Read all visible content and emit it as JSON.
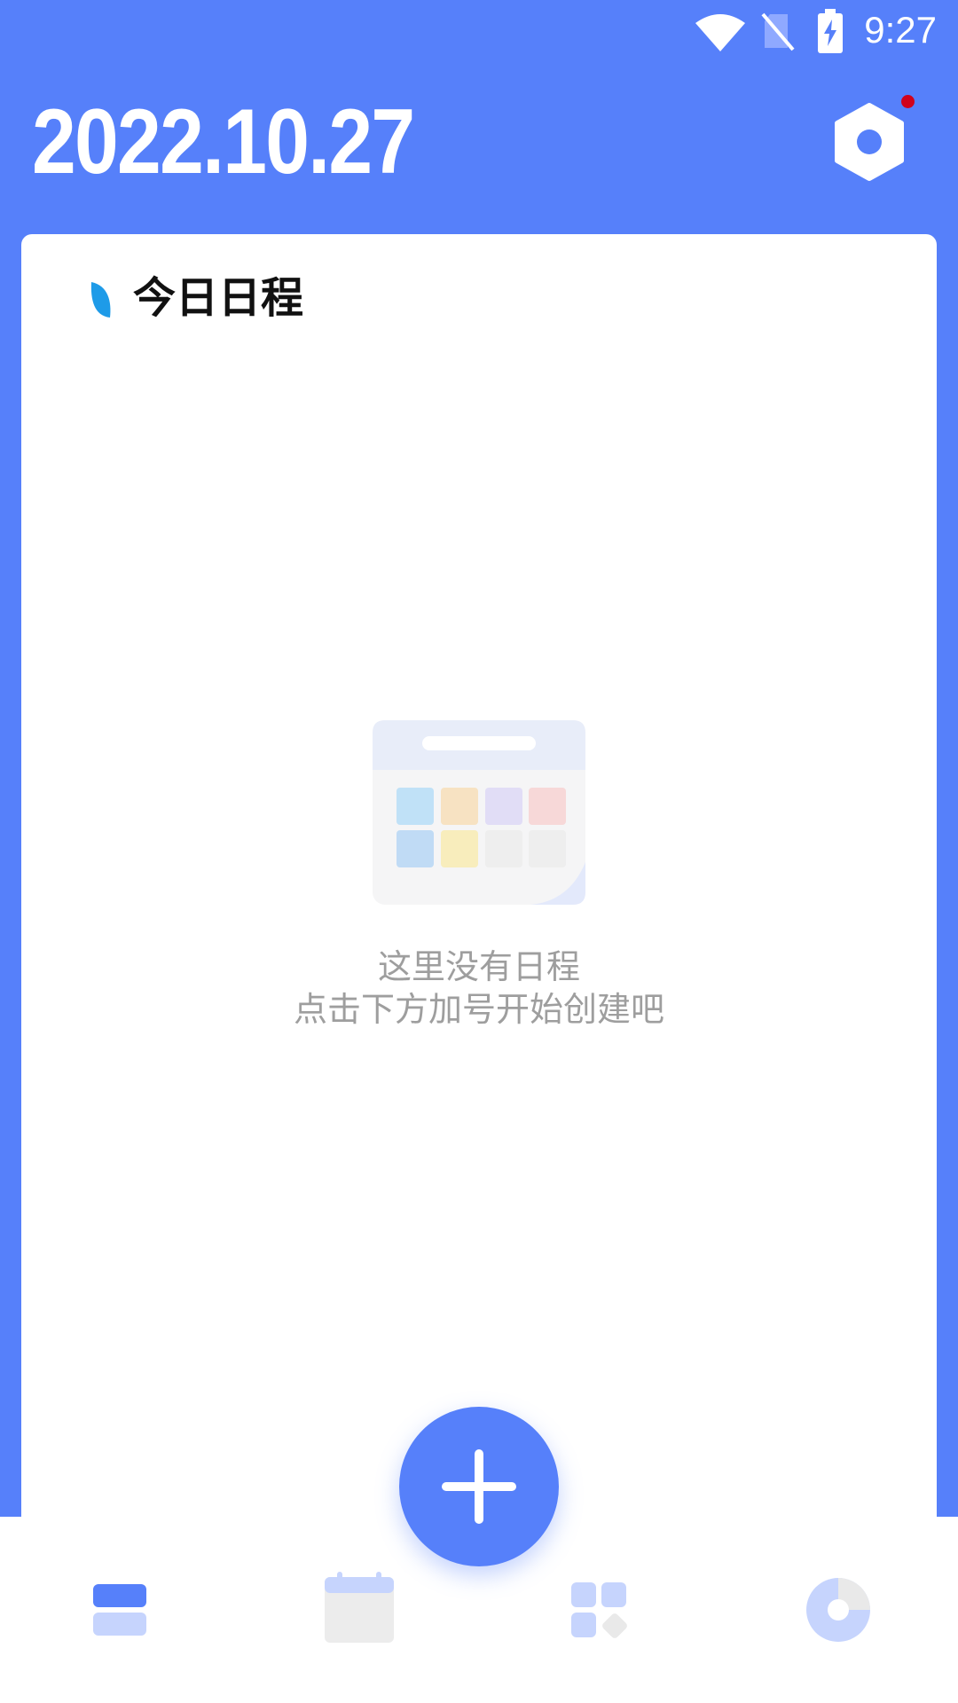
{
  "status_bar": {
    "time": "9:27",
    "icons": [
      "wifi-icon",
      "no-sim-icon",
      "battery-charging-icon"
    ]
  },
  "header": {
    "date": "2022.10.27",
    "settings_icon": "settings-hexagon-icon",
    "notification_dot_color": "#D0021B"
  },
  "schedule": {
    "title": "今日日程",
    "empty_line1": "这里没有日程",
    "empty_line2": "点击下方加号开始创建吧"
  },
  "fab": {
    "icon": "plus-icon"
  },
  "bottom_nav": {
    "items": [
      {
        "icon": "schedule-list-icon",
        "active": true
      },
      {
        "icon": "calendar-icon",
        "active": false
      },
      {
        "icon": "apps-grid-icon",
        "active": false
      },
      {
        "icon": "stats-pie-icon",
        "active": false
      }
    ]
  },
  "colors": {
    "primary": "#5680FA",
    "leaf_accent": "#1E9BE8",
    "text_muted": "#9E9E9E"
  }
}
